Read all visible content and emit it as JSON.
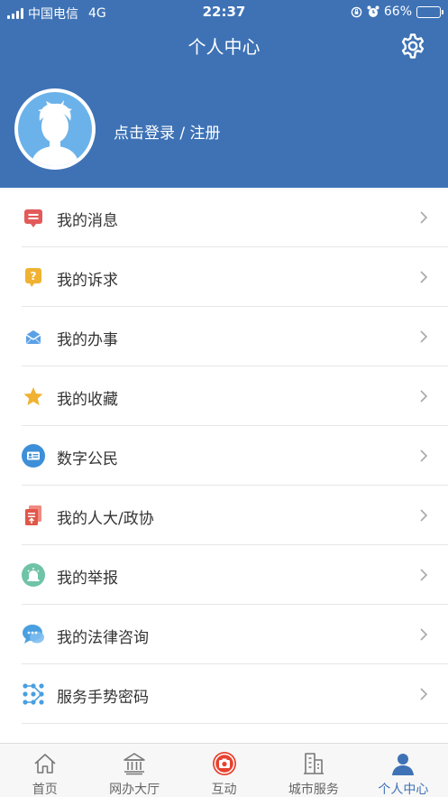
{
  "status_bar": {
    "carrier": "中国电信",
    "network": "4G",
    "time": "22:37",
    "battery_percent": "66%",
    "battery_level": 0.66
  },
  "header": {
    "title": "个人中心",
    "login_text": "点击登录 / 注册",
    "settings_icon": "gear-icon",
    "background_color": "#3e72b5"
  },
  "menu": {
    "items": [
      {
        "label": "我的消息",
        "icon": "message-icon",
        "color": "#e25b5b"
      },
      {
        "label": "我的诉求",
        "icon": "question-icon",
        "color": "#f0b232"
      },
      {
        "label": "我的办事",
        "icon": "envelope-icon",
        "color": "#5aa0e6"
      },
      {
        "label": "我的收藏",
        "icon": "star-icon",
        "color": "#f0b232"
      },
      {
        "label": "数字公民",
        "icon": "id-card-icon",
        "color": "#3d8fd8"
      },
      {
        "label": "我的人大/政协",
        "icon": "document-icon",
        "color": "#e0574a"
      },
      {
        "label": "我的举报",
        "icon": "alarm-icon",
        "color": "#6fc3a6"
      },
      {
        "label": "我的法律咨询",
        "icon": "chat-icon",
        "color": "#4a9fe0"
      },
      {
        "label": "服务手势密码",
        "icon": "gesture-icon",
        "color": "#4a9fe0"
      }
    ]
  },
  "tabbar": {
    "tabs": [
      {
        "label": "首页",
        "icon": "home-icon"
      },
      {
        "label": "网办大厅",
        "icon": "building-icon"
      },
      {
        "label": "互动",
        "icon": "camera-icon"
      },
      {
        "label": "城市服务",
        "icon": "city-icon"
      },
      {
        "label": "个人中心",
        "icon": "person-icon",
        "active": true
      }
    ],
    "active_color": "#3e72b5"
  }
}
